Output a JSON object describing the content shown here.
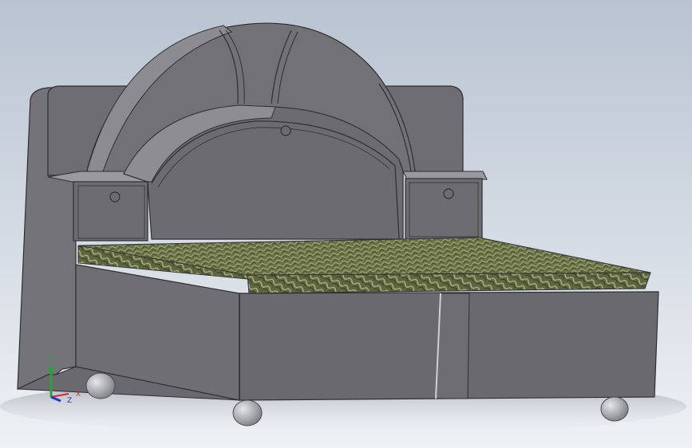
{
  "viewport": {
    "background_top": "#b9c3d1",
    "background_bottom": "#eef1f5"
  },
  "model": {
    "body_color": "#6f6f73",
    "edge_color": "#2f2f33",
    "mattress_color": "#6b7247",
    "foot_color": "#a8a9ad"
  },
  "triad": {
    "x_label": "X",
    "y_label": "Y",
    "z_label": "Z",
    "x_color": "#d8262c",
    "y_color": "#2aa13b",
    "z_color": "#1f39c7"
  }
}
